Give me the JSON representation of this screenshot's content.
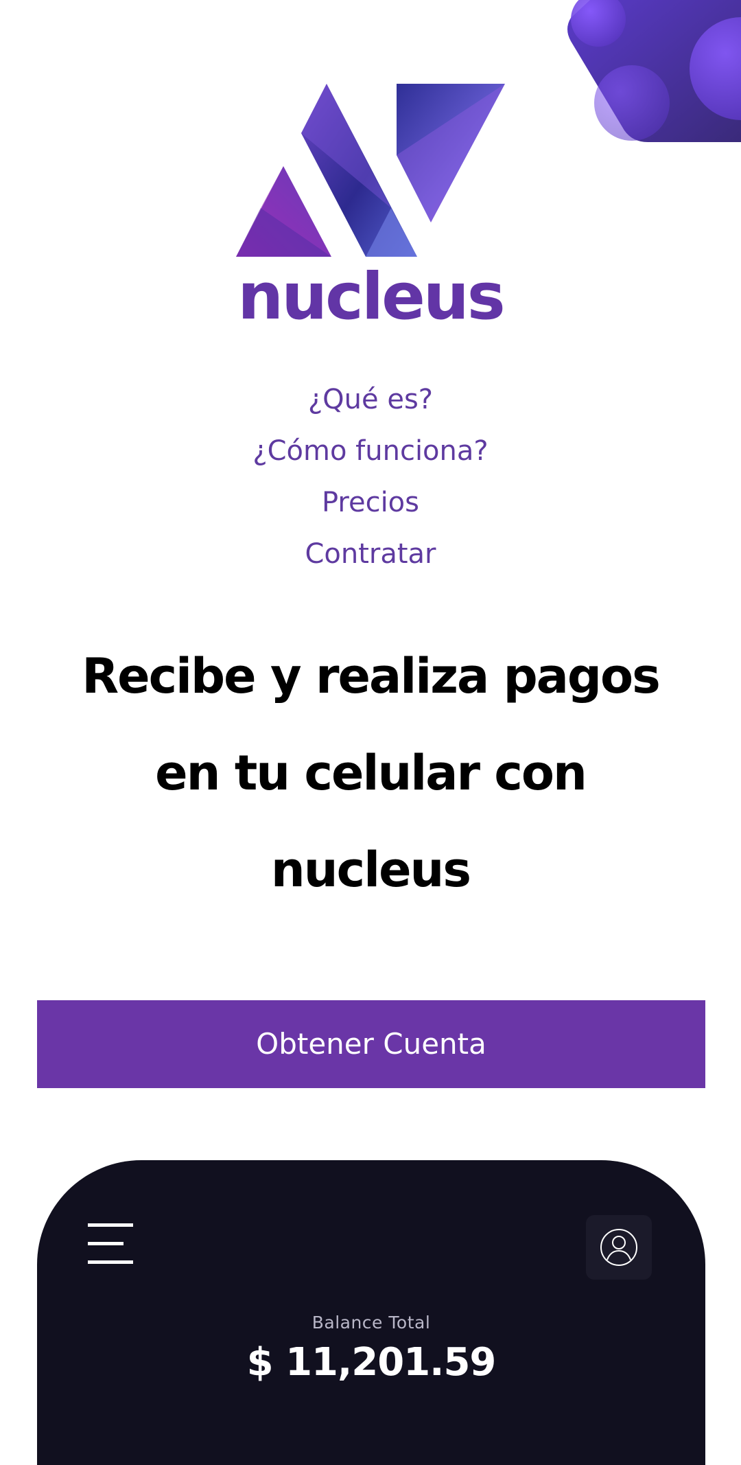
{
  "brand": {
    "name": "nucleus",
    "primary_color": "#6a36a7",
    "text_purple": "#5e3aa0",
    "logo_icon": "nucleus-logo-icon"
  },
  "nav": {
    "items": [
      {
        "label": "¿Qué es?"
      },
      {
        "label": "¿Cómo funciona?"
      },
      {
        "label": "Precios"
      },
      {
        "label": "Contratar"
      }
    ]
  },
  "hero": {
    "line1": "Recibe y realiza pagos",
    "line2": "en tu celular con",
    "line3": "nucleus"
  },
  "cta": {
    "label": "Obtener Cuenta"
  },
  "app_preview": {
    "background": "#11101f",
    "menu_icon": "hamburger-menu-icon",
    "profile_icon": "user-profile-icon",
    "balance_label": "Balance Total",
    "balance_amount": "$ 11,201.59"
  }
}
